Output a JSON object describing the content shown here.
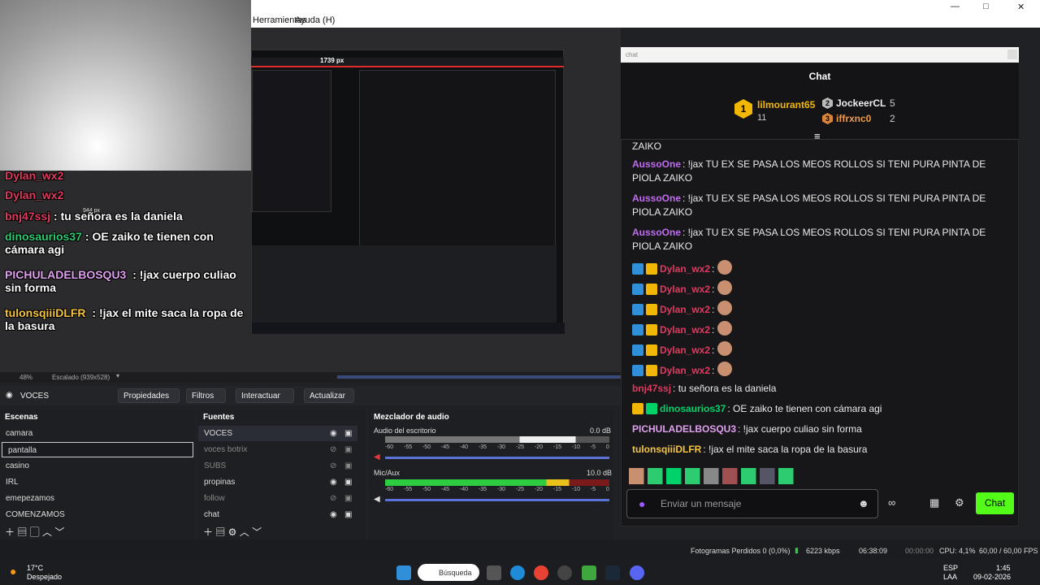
{
  "menubar": {
    "herramientas": "Herramientas",
    "ayuda": "Ayuda (H)"
  },
  "window_controls": [
    "—",
    "□",
    "✕"
  ],
  "nested": {
    "width_label": "1739 px",
    "scaled_label": "944 px"
  },
  "overlay_chat": [
    {
      "user": "Dylan_wx2",
      "text": ""
    },
    {
      "user": "Dylan_wx2",
      "text": ""
    },
    {
      "user": "bnj47ssj",
      "text": ": tu señora es la daniela"
    },
    {
      "user": "dinosaurios37",
      "text": ": OE zaiko te tienen con cámara agi"
    },
    {
      "user": "PICHULADELBOSQU3",
      "text": " : !jax cuerpo culiao sin forma"
    },
    {
      "user": "tulonsqiiiDLFR",
      "text": " : !jax el mite saca la ropa de la basura"
    }
  ],
  "preview_bar": {
    "zoom": "48%",
    "scaling": "Escalado (939x528)"
  },
  "chat": {
    "window_title": "chat",
    "header": "Chat",
    "leaders": [
      {
        "rank": "1",
        "name": "lilmourant65",
        "count": "11"
      },
      {
        "rank": "2",
        "name": "JockeerCL",
        "count": "5"
      },
      {
        "rank": "3",
        "name": "iffrxnc0",
        "count": "2"
      }
    ],
    "messages": [
      {
        "user": "",
        "text": "ZAIKO"
      },
      {
        "user": "AussoOne",
        "text": ": !jax TU EX SE PASA LOS MEOS ROLLOS SI TENI PURA PINTA DE PIOLA ZAIKO"
      },
      {
        "user": "AussoOne",
        "text": ": !jax TU EX SE PASA LOS MEOS ROLLOS SI TENI PURA PINTA DE PIOLA ZAIKO"
      },
      {
        "user": "AussoOne",
        "text": ": !jax TU EX SE PASA LOS MEOS ROLLOS SI TENI PURA PINTA DE PIOLA ZAIKO"
      },
      {
        "user": "Dylan_wx2",
        "text": ":"
      },
      {
        "user": "Dylan_wx2",
        "text": ":"
      },
      {
        "user": "Dylan_wx2",
        "text": ":"
      },
      {
        "user": "Dylan_wx2",
        "text": ":"
      },
      {
        "user": "Dylan_wx2",
        "text": ":"
      },
      {
        "user": "Dylan_wx2",
        "text": ":"
      },
      {
        "user": "bnj47ssj",
        "text": ": tu señora es la daniela"
      },
      {
        "user": "dinosaurios37",
        "text": ": OE zaiko te tienen con cámara agi"
      },
      {
        "user": "PICHULADELBOSQU3",
        "text": ": !jax cuerpo culiao sin forma"
      },
      {
        "user": "tulonsqiiiDLFR",
        "text": ": !jax el mite saca la ropa de la basura"
      }
    ],
    "input_placeholder": "Enviar un mensaje",
    "send_label": "Chat"
  },
  "scene_title": "VOCES",
  "toolbar": {
    "propiedades": "Propiedades",
    "filtros": "Filtros",
    "interactuar": "Interactuar",
    "actualizar": "Actualizar"
  },
  "scenes": {
    "title": "Escenas",
    "items": [
      "camara",
      "pantalla",
      "casino",
      "IRL",
      "emepezamos",
      "COMENZAMOS"
    ],
    "selected": "pantalla"
  },
  "sources": {
    "title": "Fuentes",
    "items": [
      "VOCES",
      "voces botrix",
      "SUBS",
      "propinas",
      "follow",
      "chat"
    ]
  },
  "mixer": {
    "title": "Mezclador de audio",
    "channels": [
      {
        "name": "Audio del escritorio",
        "db": "0.0 dB"
      },
      {
        "name": "Mic/Aux",
        "db": "10.0 dB"
      }
    ],
    "ticks": [
      "-60",
      "-55",
      "-50",
      "-45",
      "-40",
      "-35",
      "-30",
      "-25",
      "-20",
      "-15",
      "-10",
      "-5",
      "0"
    ]
  },
  "status": {
    "dropped": "Fotogramas Perdidos 0 (0,0%)",
    "kbps": "6223 kbps",
    "time_live": "06:38:09",
    "time_rec": "00:00:00",
    "cpu": "CPU: 4,1%",
    "fps": "60,00 / 60,00 FPS"
  },
  "taskbar": {
    "temp": "17°C",
    "weather": "Despejado",
    "search": "Búsqueda",
    "lang": "ESP",
    "region": "LAA",
    "time": "1:45",
    "date": "09-02-2026"
  },
  "colors": {
    "accent_green": "#00d26a",
    "obs_bg": "#1e1f22",
    "chat_bg": "#17171a"
  }
}
